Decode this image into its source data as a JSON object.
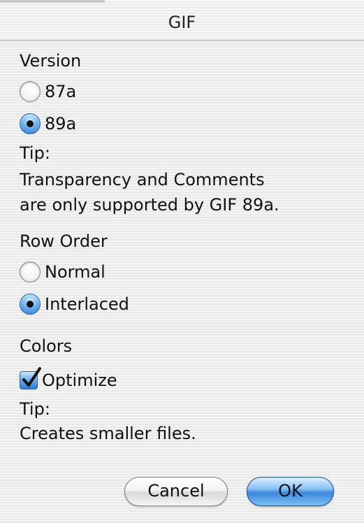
{
  "window": {
    "title": "GIF"
  },
  "version": {
    "label": "Version",
    "options": [
      {
        "label": "87a",
        "selected": false
      },
      {
        "label": "89a",
        "selected": true
      }
    ],
    "tip_label": "Tip:",
    "tip_line1": "Transparency and Comments",
    "tip_line2": "are only supported by GIF 89a."
  },
  "row_order": {
    "label": "Row Order",
    "options": [
      {
        "label": "Normal",
        "selected": false
      },
      {
        "label": "Interlaced",
        "selected": true
      }
    ]
  },
  "colors": {
    "label": "Colors",
    "optimize_label": "Optimize",
    "optimize_checked": true,
    "tip_label": "Tip:",
    "tip_line1": "Creates smaller files."
  },
  "buttons": {
    "cancel_label": "Cancel",
    "ok_label": "OK"
  },
  "accent_color": "#3b86da"
}
